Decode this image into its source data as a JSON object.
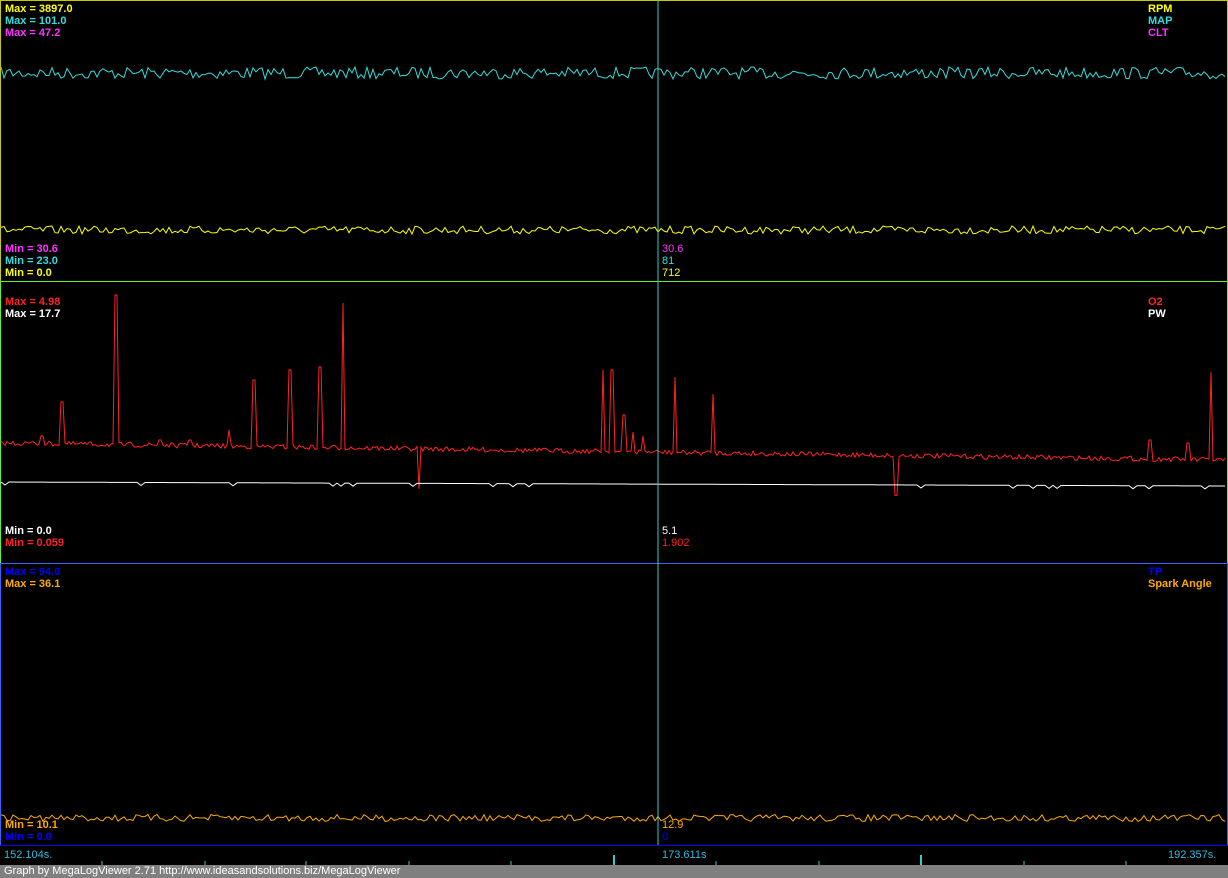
{
  "colors": {
    "rpm": "#ffff00",
    "map": "#33dddd",
    "clt": "#ff33ff",
    "o2": "#ff2222",
    "pw": "#ffffff",
    "tp": "#0000ff",
    "spark": "#ffaa00",
    "cursor": "#33cccc",
    "panel1_border": "#c8c800",
    "panel2_border": "#66ee33",
    "panel3_border": "#3366ff"
  },
  "panel1": {
    "max_rpm": "Max = 3897.0",
    "max_map": "Max = 101.0",
    "max_clt": "Max = 47.2",
    "name_rpm": "RPM",
    "name_map": "MAP",
    "name_clt": "CLT",
    "min_clt": "Min = 30.6",
    "min_map": "Min = 23.0",
    "min_rpm": "Min = 0.0",
    "cur_clt": "30.6",
    "cur_map": "81",
    "cur_rpm": "712"
  },
  "panel2": {
    "max_o2": "Max = 4.98",
    "max_pw": "Max = 17.7",
    "name_o2": "O2",
    "name_pw": "PW",
    "min_pw": "Min = 0.0",
    "min_o2": "Min = 0.059",
    "cur_pw": "5.1",
    "cur_o2": "1.902"
  },
  "panel3": {
    "max_tp": "Max = 94.0",
    "max_spark": "Max = 36.1",
    "name_tp": "TP",
    "name_spark": "Spark Angle",
    "min_spark": "Min = 10.1",
    "min_tp": "Min = 0.0",
    "cur_spark": "12.9",
    "cur_tp": "0"
  },
  "timeline": {
    "start": "152.104s.",
    "cursor": "173.611s",
    "end": "192.357s."
  },
  "footer": "Graph by MegaLogViewer 2.71 http://www.ideasandsolutions.biz/MegaLogViewer"
}
